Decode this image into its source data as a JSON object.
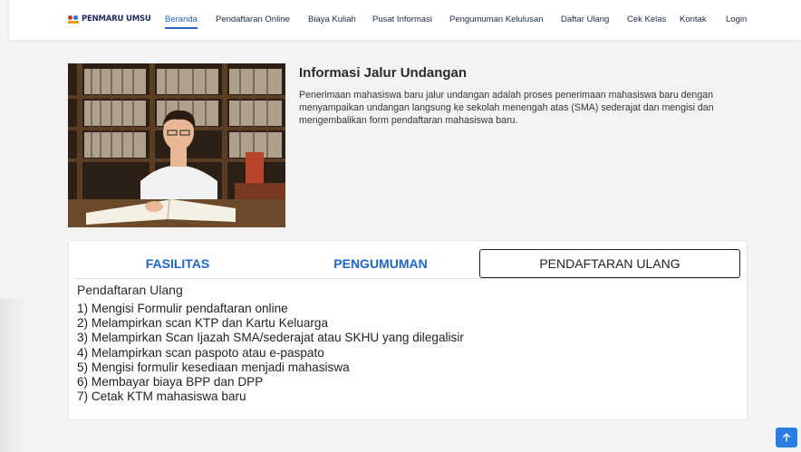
{
  "brand": {
    "name": "PENMARU UMSU"
  },
  "nav": {
    "items": [
      {
        "label": "Beranda",
        "active": true
      },
      {
        "label": "Pendaftaran Online",
        "active": false
      },
      {
        "label": "Biaya Kuliah",
        "active": false
      },
      {
        "label": "Pusat Informasi",
        "active": false
      },
      {
        "label": "Pengumuman Kelulusan",
        "active": false
      },
      {
        "label": "Daftar Ulang",
        "active": false
      },
      {
        "label": "Cek Kelas",
        "active": false
      },
      {
        "label": "Kontak",
        "active": false
      },
      {
        "label": "Login",
        "active": false
      }
    ]
  },
  "info": {
    "title": "Informasi Jalur Undangan",
    "description": "Penerimaan mahasiswa baru jalur undangan adalah proses penerimaan mahasiswa baru dengan menyampaikan undangan langsung ke sekolah menengah atas (SMA) sederajat dan mengisi dan mengembalikan form pendaftaran mahasiswa baru."
  },
  "tabs": [
    {
      "label": "FASILITAS",
      "active": false
    },
    {
      "label": "PENGUMUMAN",
      "active": false
    },
    {
      "label": "PENDAFTARAN ULANG",
      "active": true
    }
  ],
  "panel": {
    "title": "Pendaftaran Ulang",
    "steps": [
      "1) Mengisi Formulir pendaftaran online",
      "2) Melampirkan scan KTP dan Kartu Keluarga",
      "3) Melampirkan Scan Ijazah SMA/sederajat atau SKHU yang dilegalisir",
      "4) Melampirkan scan paspoto atau e-paspato",
      "5) Mengisi formulir kesediaan menjadi mahasiswa",
      "6) Membayar biaya BPP dan DPP",
      "7) Cetak KTM mahasiswa baru"
    ]
  },
  "colors": {
    "accent": "#2563c9",
    "tab_text": "#1f66c9",
    "background": "#f3f3f4",
    "back_to_top": "#2a7de1"
  },
  "icons": {
    "back_to_top": "arrow-up-icon",
    "logo": "umsu-logo-icon"
  }
}
